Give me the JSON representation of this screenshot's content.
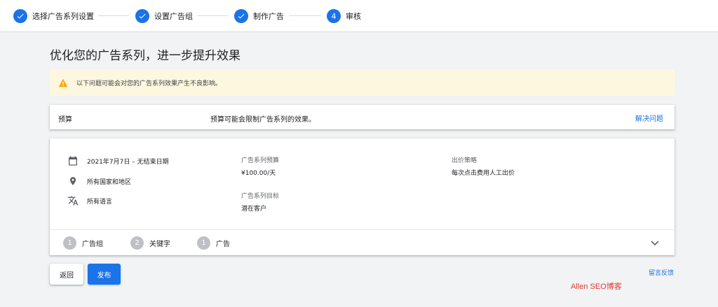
{
  "stepper": {
    "steps": [
      {
        "label": "选择广告系列设置",
        "state": "done",
        "icon": "check-icon"
      },
      {
        "label": "设置广告组",
        "state": "done",
        "icon": "check-icon"
      },
      {
        "label": "制作广告",
        "state": "done",
        "icon": "check-icon"
      },
      {
        "label": "审核",
        "state": "current",
        "number": "4"
      }
    ],
    "accent_color": "#1a73e8"
  },
  "page": {
    "title": "优化您的广告系列，进一步提升效果"
  },
  "warning": {
    "icon": "warning-icon",
    "text": "以下问题可能会对您的广告系列效果产生不良影响。",
    "background_color": "#fef7e0"
  },
  "issue": {
    "name": "预算",
    "description": "预算可能会限制广告系列的效果。",
    "action_label": "解决问题"
  },
  "summary": {
    "date_range": "2021年7月7日 – 无结束日期",
    "location": "所有国家和地区",
    "language": "所有语言",
    "budget_label": "广告系列预算",
    "budget_value": "¥100.00/天",
    "goal_label": "广告系列目标",
    "goal_value": "潜在客户",
    "bidding_label": "出价策略",
    "bidding_value": "每次点击费用人工出价"
  },
  "sub_steps": [
    {
      "number": "1",
      "label": "广告组"
    },
    {
      "number": "2",
      "label": "关键字"
    },
    {
      "number": "1",
      "label": "广告"
    }
  ],
  "actions": {
    "back_label": "返回",
    "publish_label": "发布",
    "feedback_label": "留言反馈"
  },
  "watermark": {
    "text": "Allen SEO博客",
    "color": "#e53935"
  }
}
